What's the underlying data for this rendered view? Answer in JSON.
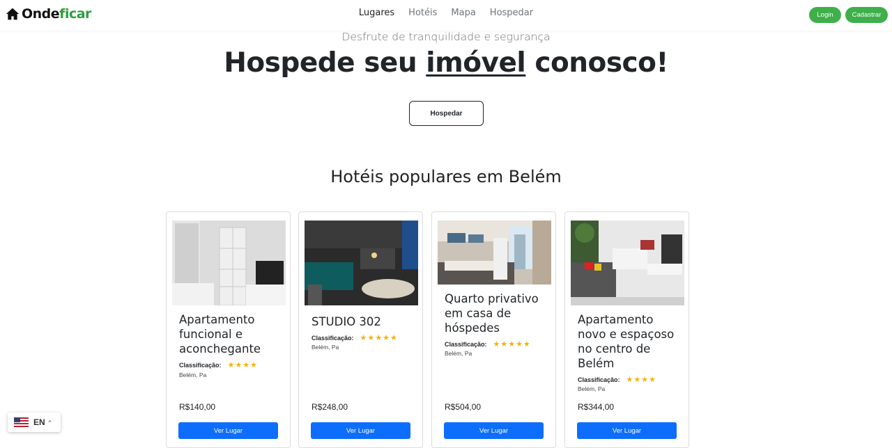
{
  "brand": {
    "part1": "Onde",
    "part2": "ficar",
    "accent_color": "#2e9e3e"
  },
  "nav": {
    "items": [
      {
        "label": "Lugares",
        "active": true
      },
      {
        "label": "Hotéis",
        "active": false
      },
      {
        "label": "Mapa",
        "active": false
      },
      {
        "label": "Hospedar",
        "active": false
      }
    ],
    "login_label": "Login",
    "signup_label": "Cadastrar"
  },
  "hero": {
    "subtitle": "Desfrute de tranquilidade e segurança",
    "title_before": "Hospede seu ",
    "title_underlined": "imóvel",
    "title_after": " conosco!",
    "button_label": "Hospedar"
  },
  "section": {
    "title": "Hotéis populares em Belém"
  },
  "cards": [
    {
      "title": "Apartamento funcional e aconchegante",
      "rating_label": "Classificação:",
      "stars": "★★★★",
      "location": "Belém, Pa",
      "price": "R$140,00",
      "button_label": "Ver Lugar"
    },
    {
      "title": "STUDIO 302",
      "rating_label": "Classificação:",
      "stars": "★★★★★",
      "location": "Belém, Pa",
      "price": "R$248,00",
      "button_label": "Ver Lugar"
    },
    {
      "title": "Quarto privativo em casa de hóspedes",
      "rating_label": "Classificação:",
      "stars": "★★★★★",
      "location": "Belém, Pa",
      "price": "R$504,00",
      "button_label": "Ver Lugar"
    },
    {
      "title": "Apartamento novo e espaçoso no centro de Belém",
      "rating_label": "Classificação:",
      "stars": "★★★★",
      "location": "Belém, Pa",
      "price": "R$344,00",
      "button_label": "Ver Lugar"
    }
  ],
  "language": {
    "code": "EN"
  }
}
